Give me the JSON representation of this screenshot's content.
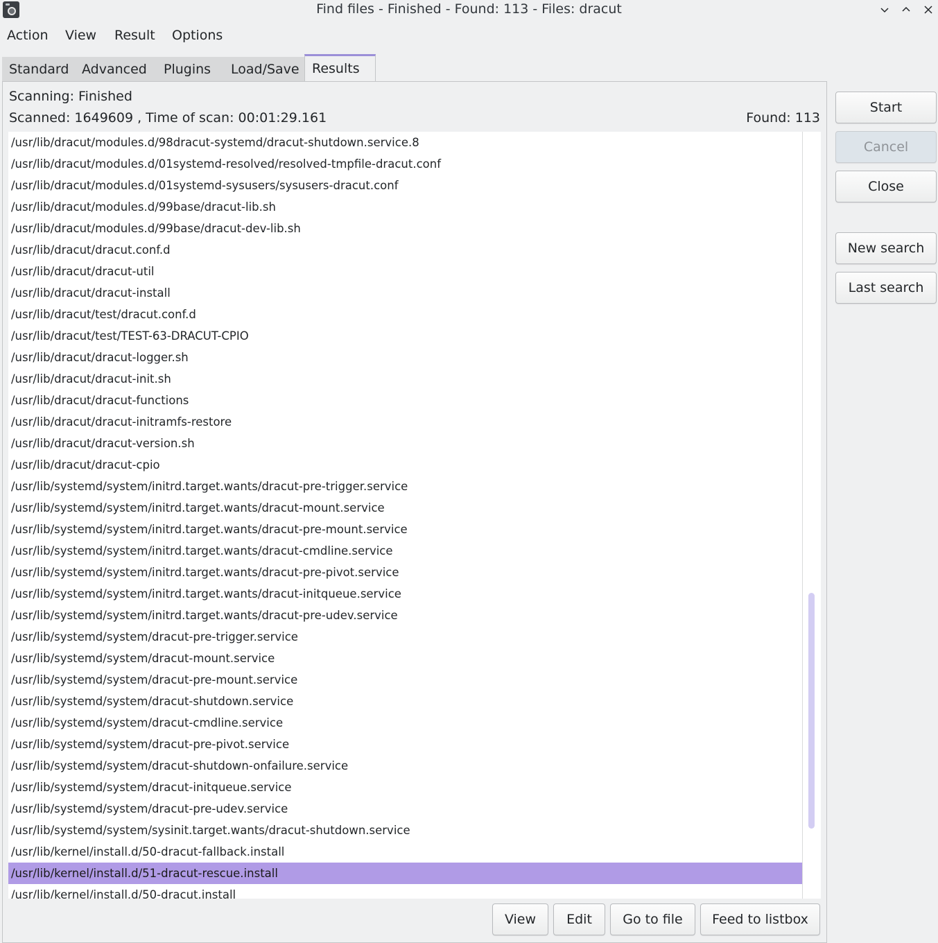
{
  "window": {
    "title": "Find files - Finished - Found: 113 - Files: dracut",
    "app_icon": "camera-disk-icon",
    "controls": [
      "minimize",
      "maximize",
      "close"
    ]
  },
  "menu": [
    "Action",
    "View",
    "Result",
    "Options"
  ],
  "tabs": [
    "Standard",
    "Advanced",
    "Plugins",
    "Load/Save",
    "Results"
  ],
  "active_tab": "Results",
  "status": {
    "scanning": "Scanning: Finished",
    "scanned": "Scanned: 1649609 , Time of scan: 00:01:29.161",
    "found": "Found: 113"
  },
  "results": [
    "/usr/lib/dracut/modules.d/98dracut-systemd/dracut-shutdown.service.8",
    "/usr/lib/dracut/modules.d/01systemd-resolved/resolved-tmpfile-dracut.conf",
    "/usr/lib/dracut/modules.d/01systemd-sysusers/sysusers-dracut.conf",
    "/usr/lib/dracut/modules.d/99base/dracut-lib.sh",
    "/usr/lib/dracut/modules.d/99base/dracut-dev-lib.sh",
    "/usr/lib/dracut/dracut.conf.d",
    "/usr/lib/dracut/dracut-util",
    "/usr/lib/dracut/dracut-install",
    "/usr/lib/dracut/test/dracut.conf.d",
    "/usr/lib/dracut/test/TEST-63-DRACUT-CPIO",
    "/usr/lib/dracut/dracut-logger.sh",
    "/usr/lib/dracut/dracut-init.sh",
    "/usr/lib/dracut/dracut-functions",
    "/usr/lib/dracut/dracut-initramfs-restore",
    "/usr/lib/dracut/dracut-version.sh",
    "/usr/lib/dracut/dracut-cpio",
    "/usr/lib/systemd/system/initrd.target.wants/dracut-pre-trigger.service",
    "/usr/lib/systemd/system/initrd.target.wants/dracut-mount.service",
    "/usr/lib/systemd/system/initrd.target.wants/dracut-pre-mount.service",
    "/usr/lib/systemd/system/initrd.target.wants/dracut-cmdline.service",
    "/usr/lib/systemd/system/initrd.target.wants/dracut-pre-pivot.service",
    "/usr/lib/systemd/system/initrd.target.wants/dracut-initqueue.service",
    "/usr/lib/systemd/system/initrd.target.wants/dracut-pre-udev.service",
    "/usr/lib/systemd/system/dracut-pre-trigger.service",
    "/usr/lib/systemd/system/dracut-mount.service",
    "/usr/lib/systemd/system/dracut-pre-mount.service",
    "/usr/lib/systemd/system/dracut-shutdown.service",
    "/usr/lib/systemd/system/dracut-cmdline.service",
    "/usr/lib/systemd/system/dracut-pre-pivot.service",
    "/usr/lib/systemd/system/dracut-shutdown-onfailure.service",
    "/usr/lib/systemd/system/dracut-initqueue.service",
    "/usr/lib/systemd/system/dracut-pre-udev.service",
    "/usr/lib/systemd/system/sysinit.target.wants/dracut-shutdown.service",
    "/usr/lib/kernel/install.d/50-dracut-fallback.install",
    "/usr/lib/kernel/install.d/51-dracut-rescue.install",
    "/usr/lib/kernel/install.d/50-dracut.install"
  ],
  "selected_index": 34,
  "side_buttons": {
    "start": "Start",
    "cancel": "Cancel",
    "close": "Close",
    "new_search": "New search",
    "last_search": "Last search"
  },
  "bottom_buttons": {
    "view": "View",
    "edit": "Edit",
    "go_to_file": "Go to file",
    "feed_to_listbox": "Feed to listbox"
  },
  "colors": {
    "selection": "#b09be6",
    "active_tab_accent": "#9b8fd8",
    "scroll_thumb": "#d3cdf3"
  }
}
